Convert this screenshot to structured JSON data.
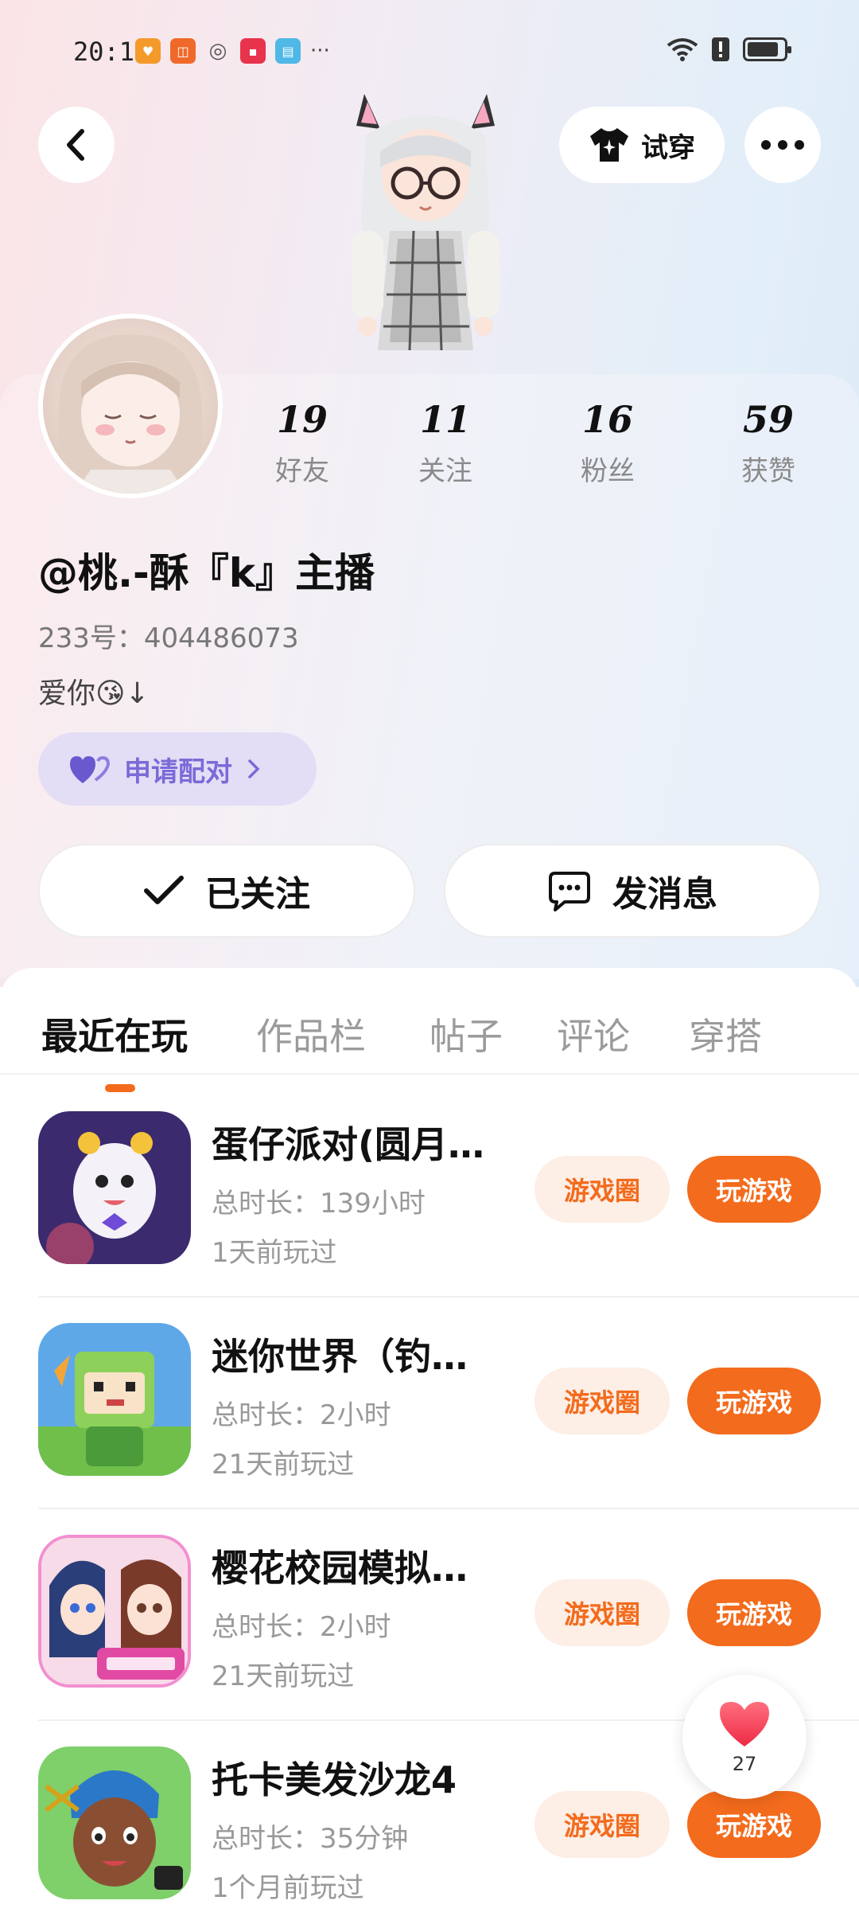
{
  "status_bar": {
    "time": "20:10",
    "more_glyph": "···"
  },
  "header": {
    "tryon_label": "试穿"
  },
  "stats": [
    {
      "value": "19",
      "label": "好友"
    },
    {
      "value": "11",
      "label": "关注"
    },
    {
      "value": "16",
      "label": "粉丝"
    },
    {
      "value": "59",
      "label": "获赞"
    }
  ],
  "profile": {
    "nickname": "@桃.-酥『k』主播",
    "uid": "233号：404486073",
    "bio": "爱你😘↓",
    "pair_label": "申请配对"
  },
  "actions": {
    "follow_label": "已关注",
    "message_label": "发消息"
  },
  "tabs": [
    {
      "label": "最近在玩",
      "active": true
    },
    {
      "label": "作品栏",
      "active": false
    },
    {
      "label": "帖子",
      "active": false
    },
    {
      "label": "评论",
      "active": false
    },
    {
      "label": "穿搭",
      "active": false
    }
  ],
  "games": [
    {
      "name": "蛋仔派对(圆月…",
      "duration": "总时长：139小时",
      "last_played": "1天前玩过",
      "circle_label": "游戏圈",
      "play_label": "玩游戏"
    },
    {
      "name": "迷你世界（钓…",
      "duration": "总时长：2小时",
      "last_played": "21天前玩过",
      "circle_label": "游戏圈",
      "play_label": "玩游戏"
    },
    {
      "name": "樱花校园模拟…",
      "duration": "总时长：2小时",
      "last_played": "21天前玩过",
      "circle_label": "游戏圈",
      "play_label": "玩游戏"
    },
    {
      "name": "托卡美发沙龙4",
      "duration": "总时长：35分钟",
      "last_played": "1个月前玩过",
      "circle_label": "游戏圈",
      "play_label": "玩游戏"
    }
  ],
  "like_button": {
    "count": "27"
  },
  "colors": {
    "accent": "#f36b1c",
    "pair": "#7c6ad7"
  },
  "icons": [
    "back-arrow-icon",
    "tshirt-icon",
    "more-dots-icon",
    "heart-icon",
    "check-icon",
    "chat-icon",
    "wifi-icon",
    "battery-icon"
  ]
}
